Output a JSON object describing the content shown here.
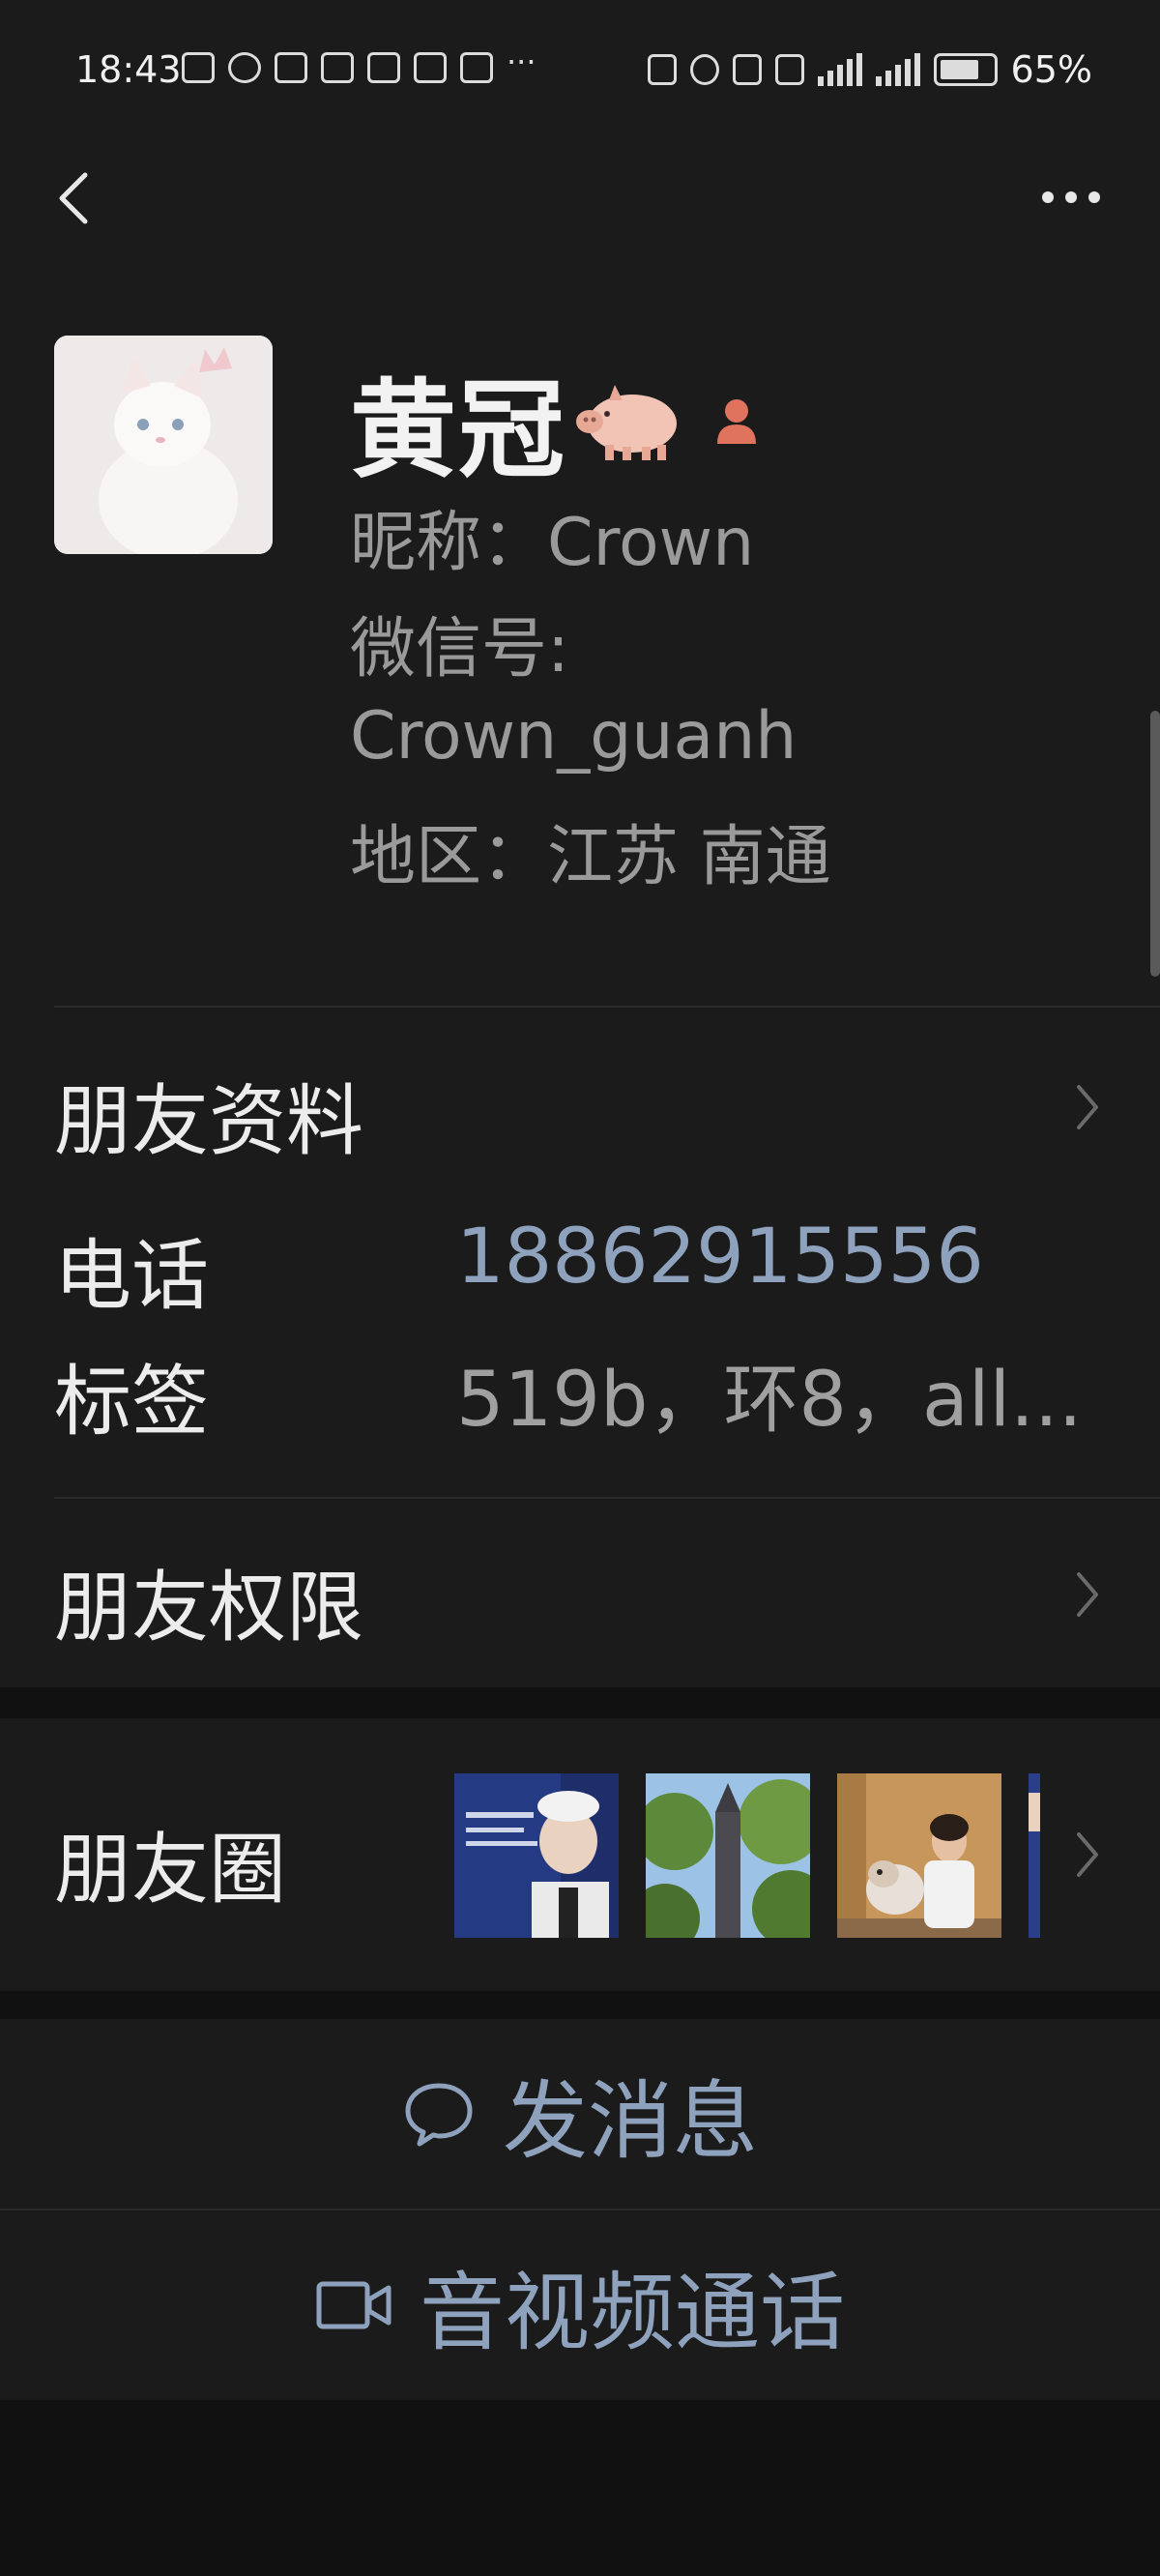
{
  "status_bar": {
    "time": "18:43",
    "battery": "65%",
    "battery_level": 0.65,
    "overflow": "···"
  },
  "header": {
    "back_icon": "chevron-left-icon",
    "more_icon": "more-horizontal-icon"
  },
  "profile": {
    "name": "黄冠",
    "nickname": "昵称：Crown",
    "wechat_id_label": "微信号:",
    "wechat_id_value": "Crown_guanh",
    "region": "地区：江苏  南通"
  },
  "cells": {
    "friend_info": "朋友资料",
    "phone_label": "电话",
    "phone_value": "18862915556",
    "tags_label": "标签",
    "tags_value": "519b，环8，all...",
    "permissions": "朋友权限",
    "moments": "朋友圈"
  },
  "actions": {
    "message": "发消息",
    "call": "音视频通话"
  },
  "colors": {
    "background": "#111111",
    "panel": "#1b1b1b",
    "link": "#8ea2bd",
    "secondary_text": "#9a9a9a"
  }
}
